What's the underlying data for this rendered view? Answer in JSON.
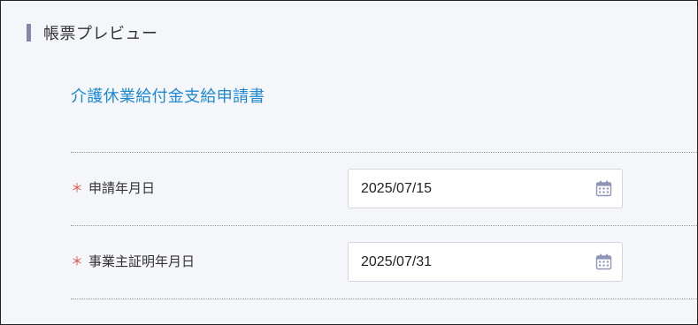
{
  "section": {
    "title": "帳票プレビュー"
  },
  "form": {
    "title": "介護休業給付金支給申請書",
    "fields": [
      {
        "required_mark": "＊",
        "label": "申請年月日",
        "value": "2025/07/15",
        "icon": "calendar-icon"
      },
      {
        "required_mark": "＊",
        "label": "事業主証明年月日",
        "value": "2025/07/31",
        "icon": "calendar-icon"
      }
    ]
  },
  "colors": {
    "background": "#f5f6fa",
    "accent_bar": "#8388a8",
    "title_link": "#1e88d2",
    "required": "#d9534f",
    "calendar_icon": "#8f94b8"
  }
}
